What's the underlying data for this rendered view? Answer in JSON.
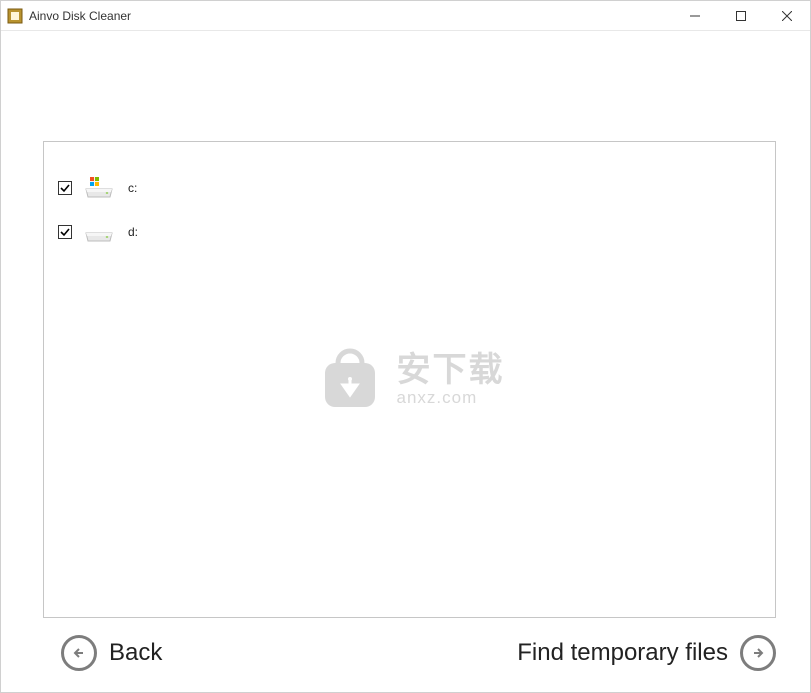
{
  "window": {
    "title": "Ainvo Disk Cleaner"
  },
  "drives": [
    {
      "label": "c:",
      "checked": true,
      "system": true
    },
    {
      "label": "d:",
      "checked": true,
      "system": false
    }
  ],
  "watermark": {
    "cn": "安下载",
    "domain": "anxz.com"
  },
  "footer": {
    "back_label": "Back",
    "next_label": "Find temporary files"
  }
}
